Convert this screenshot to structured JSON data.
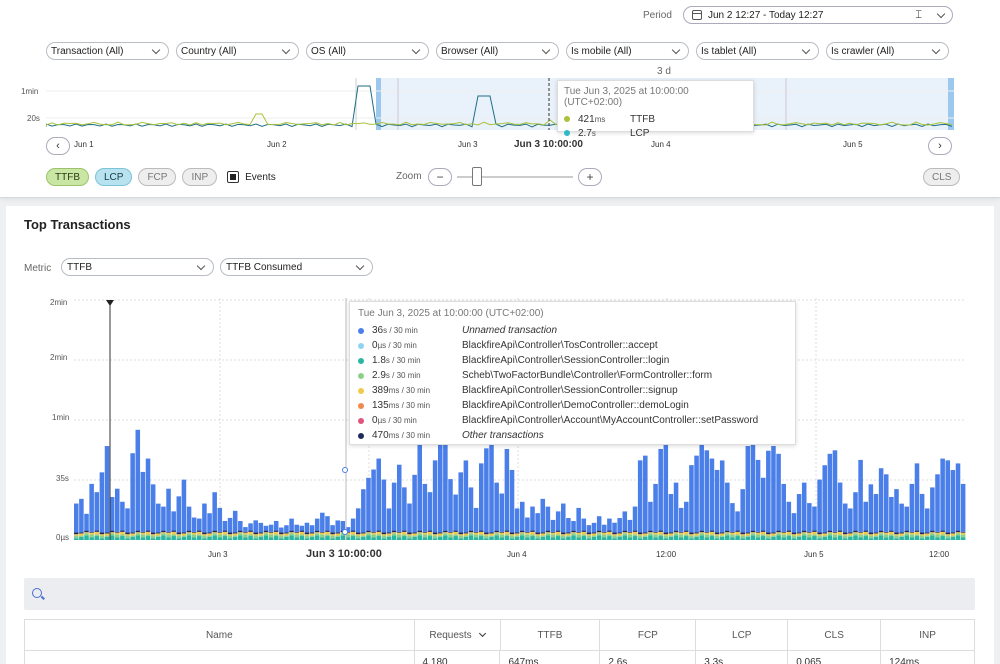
{
  "header": {
    "period_label": "Period",
    "period_value": "Jun 2 12:27 - Today 12:27",
    "filters": [
      {
        "label": "Transaction (All)"
      },
      {
        "label": "Country (All)"
      },
      {
        "label": "OS (All)"
      },
      {
        "label": "Browser (All)"
      },
      {
        "label": "Is mobile (All)"
      },
      {
        "label": "Is tablet (All)"
      },
      {
        "label": "Is crawler (All)"
      }
    ],
    "range_label": "3 d",
    "mini_y": [
      "1min",
      "20s"
    ],
    "mini_x": [
      "Jun 1",
      "Jun 2",
      "Jun 3",
      "Jun 3  10:00:00",
      "Jun 4",
      "Jun 5"
    ],
    "prev_arrow": "‹",
    "next_arrow": "›"
  },
  "overview_tooltip": {
    "title": "Tue Jun 3, 2025 at 10:00:00 (UTC+02:00)",
    "rows": [
      {
        "value": "421",
        "unit": "ms",
        "name": "TTFB",
        "color": "#a8c33a"
      },
      {
        "value": "2.7",
        "unit": "s",
        "name": "LCP",
        "color": "#2fb8c9"
      }
    ]
  },
  "metric_toggles": {
    "ttfb": "TTFB",
    "lcp": "LCP",
    "fcp": "FCP",
    "inp": "INP",
    "events": "Events",
    "cls": "CLS"
  },
  "zoom": {
    "label": "Zoom",
    "minus": "−",
    "plus": "+",
    "level": 0.17
  },
  "top_transactions": {
    "title": "Top Transactions",
    "metric_label": "Metric",
    "metric_value": "TTFB",
    "aggregate_value": "TTFB Consumed",
    "y_labels": [
      "2min",
      "2min",
      "1min",
      "35s",
      "0µs"
    ],
    "x_labels": [
      "Jun 3",
      "Jun 3  10:00:00",
      "Jun 4",
      "12:00",
      "Jun 5",
      "12:00"
    ]
  },
  "tx_tooltip": {
    "title": "Tue Jun 3, 2025 at 10:00:00 (UTC+02:00)",
    "rows": [
      {
        "value": "36",
        "unit": "s / 30 min",
        "name": "Unnamed transaction",
        "italic": true,
        "color": "#4a7ee8"
      },
      {
        "value": "0",
        "unit": "µs / 30 min",
        "name": "BlackfireApi\\Controller\\TosController::accept",
        "italic": false,
        "color": "#8fd3f2"
      },
      {
        "value": "1.8",
        "unit": "s / 30 min",
        "name": "BlackfireApi\\Controller\\SessionController::login",
        "italic": false,
        "color": "#2bb5a3"
      },
      {
        "value": "2.9",
        "unit": "s / 30 min",
        "name": "Scheb\\TwoFactorBundle\\Controller\\FormController::form",
        "italic": false,
        "color": "#8ccf8a"
      },
      {
        "value": "389",
        "unit": "ms / 30 min",
        "name": "BlackfireApi\\Controller\\SessionController::signup",
        "italic": false,
        "color": "#f2c94c"
      },
      {
        "value": "135",
        "unit": "ms / 30 min",
        "name": "BlackfireApi\\Controller\\DemoController::demoLogin",
        "italic": false,
        "color": "#f08a4b"
      },
      {
        "value": "0",
        "unit": "µs / 30 min",
        "name": "BlackfireApi\\Controller\\Account\\MyAccountController::setPassword",
        "italic": false,
        "color": "#e0567a"
      },
      {
        "value": "470",
        "unit": "ms / 30 min",
        "name": "Other transactions",
        "italic": true,
        "color": "#1f2a5c"
      }
    ]
  },
  "table": {
    "columns": [
      "Name",
      "Requests",
      "TTFB",
      "FCP",
      "LCP",
      "CLS",
      "INP"
    ],
    "rows": [
      [
        "",
        "4,180",
        "647ms",
        "2.6s",
        "3.3s",
        "0.065",
        "124ms"
      ]
    ]
  },
  "chart_data": [
    {
      "type": "line",
      "series": [
        {
          "name": "TTFB"
        },
        {
          "name": "LCP"
        }
      ],
      "yticks": [
        "1min",
        "20s"
      ],
      "xticks": [
        "Jun 1",
        "Jun 2",
        "Jun 3",
        "Jun 4",
        "Jun 5"
      ],
      "highlight": {
        "x": "Jun 3 10:00:00",
        "TTFB_ms": 421,
        "LCP_s": 2.7
      }
    },
    {
      "type": "bar",
      "stacked": true,
      "yticks": [
        "2min",
        "2min",
        "1min",
        "35s",
        "0µs"
      ],
      "xticks": [
        "Jun 3",
        "Jun 4",
        "12:00",
        "Jun 5",
        "12:00"
      ],
      "series": [
        {
          "name": "Unnamed transaction"
        },
        {
          "name": "BlackfireApi\\Controller\\TosController::accept"
        },
        {
          "name": "BlackfireApi\\Controller\\SessionController::login"
        },
        {
          "name": "Scheb\\TwoFactorBundle\\Controller\\FormController::form"
        },
        {
          "name": "BlackfireApi\\Controller\\SessionController::signup"
        },
        {
          "name": "BlackfireApi\\Controller\\DemoController::demoLogin"
        },
        {
          "name": "BlackfireApi\\Controller\\Account\\MyAccountController::setPassword"
        },
        {
          "name": "Other transactions"
        }
      ],
      "unnamed_share": [
        0.12,
        0.14,
        0.07,
        0.2,
        0.16,
        0.25,
        0.36,
        0.14,
        0.18,
        0.12,
        0.1,
        0.33,
        0.42,
        0.25,
        0.3,
        0.2,
        0.12,
        0.1,
        0.18,
        0.08,
        0.15,
        0.22,
        0.1,
        0.06,
        0.05,
        0.12,
        0.08,
        0.16,
        0.1,
        0.04,
        0.06,
        0.09,
        0.04,
        0.02,
        0.03,
        0.05,
        0.04,
        0.02,
        0.03,
        0.04,
        0.02,
        0.03,
        0.05,
        0.03,
        0.02,
        0.04,
        0.03,
        0.05,
        0.08,
        0.06,
        0.03,
        0.05,
        0.04,
        0.02,
        0.05,
        0.1,
        0.18,
        0.22,
        0.26,
        0.3,
        0.22,
        0.1,
        0.2,
        0.28,
        0.18,
        0.12,
        0.24,
        0.38,
        0.2,
        0.16,
        0.3,
        0.42,
        0.36,
        0.22,
        0.15,
        0.25,
        0.3,
        0.18,
        0.1,
        0.28,
        0.35,
        0.4,
        0.2,
        0.16,
        0.34,
        0.26,
        0.1,
        0.12,
        0.06,
        0.1,
        0.08,
        0.14,
        0.1,
        0.05,
        0.08,
        0.12,
        0.06,
        0.04,
        0.1,
        0.05,
        0.03,
        0.04,
        0.06,
        0.03,
        0.05,
        0.04,
        0.06,
        0.08,
        0.05,
        0.1,
        0.3,
        0.32,
        0.12,
        0.2,
        0.34,
        0.38,
        0.16,
        0.2,
        0.1,
        0.12,
        0.28,
        0.32,
        0.36,
        0.34,
        0.3,
        0.26,
        0.3,
        0.2,
        0.12,
        0.08,
        0.18,
        0.36,
        0.38,
        0.3,
        0.22,
        0.34,
        0.36,
        0.32,
        0.2,
        0.12,
        0.08,
        0.16,
        0.2,
        0.12,
        0.1,
        0.22,
        0.28,
        0.32,
        0.34,
        0.2,
        0.12,
        0.1,
        0.16,
        0.3,
        0.12,
        0.2,
        0.16,
        0.26,
        0.24,
        0.14,
        0.18,
        0.12,
        0.1,
        0.2,
        0.28,
        0.16,
        0.1,
        0.18,
        0.24,
        0.3,
        0.3,
        0.26,
        0.28,
        0.2
      ]
    }
  ]
}
